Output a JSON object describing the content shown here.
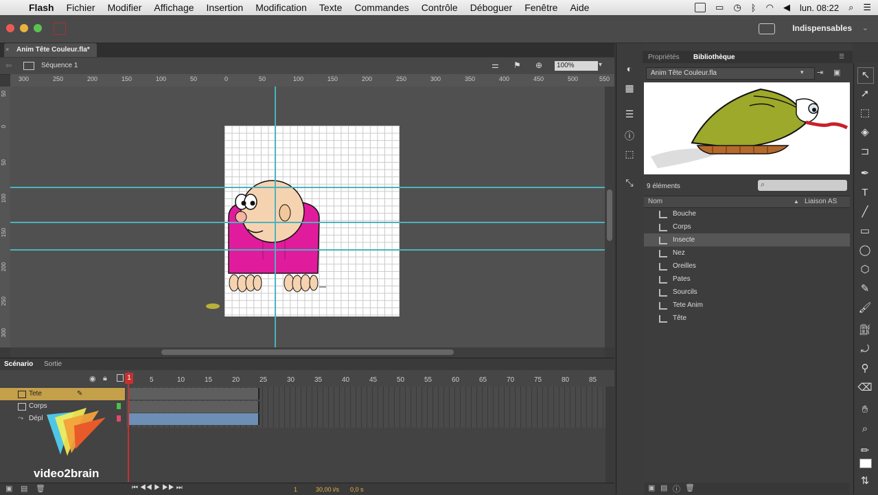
{
  "menubar": {
    "app": "Flash",
    "items": [
      "Fichier",
      "Modifier",
      "Affichage",
      "Insertion",
      "Modification",
      "Texte",
      "Commandes",
      "Contrôle",
      "Déboguer",
      "Fenêtre",
      "Aide"
    ],
    "clock": "lun. 08:22"
  },
  "titlebar": {
    "workspace": "Indispensables"
  },
  "document": {
    "tab": "Anim Tête Couleur.fla*",
    "scene": "Séquence 1",
    "zoom": "100%"
  },
  "ruler": {
    "h": [
      "300",
      "250",
      "200",
      "150",
      "100",
      "50",
      "0",
      "50",
      "100",
      "150",
      "200",
      "250",
      "300",
      "350",
      "400",
      "450",
      "500",
      "550"
    ],
    "v": [
      "50",
      "0",
      "50",
      "100",
      "150",
      "200",
      "250",
      "300"
    ]
  },
  "timeline": {
    "tabs": [
      "Scénario",
      "Sortie"
    ],
    "frames": [
      "1",
      "5",
      "10",
      "15",
      "20",
      "25",
      "30",
      "35",
      "40",
      "45",
      "50",
      "55",
      "60",
      "65",
      "70",
      "75",
      "80",
      "85"
    ],
    "layers": [
      {
        "name": "Tete",
        "selected": true
      },
      {
        "name": "Corps",
        "selected": false
      },
      {
        "name": "Dépl",
        "selected": false
      }
    ],
    "footer": {
      "frame": "1",
      "fps": "30,00 i/s",
      "time": "0,0 s"
    }
  },
  "logo": {
    "text": "video2brain"
  },
  "panel": {
    "tabs": [
      "Propriétés",
      "Bibliothèque"
    ],
    "library_file": "Anim Tête Couleur.fla",
    "count": "9 éléments",
    "col_name": "Nom",
    "col_link": "Liaison AS",
    "items": [
      "Bouche",
      "Corps",
      "Insecte",
      "Nez",
      "Oreilles",
      "Pates",
      "Sourcils",
      "Tete Anim",
      "Tête"
    ],
    "selected": "Insecte"
  },
  "colors": {
    "accent_guide": "#4bb3be",
    "playhead": "#c93030",
    "layer_selected": "#c4a04a",
    "layer_span": "#6d8fb5"
  }
}
